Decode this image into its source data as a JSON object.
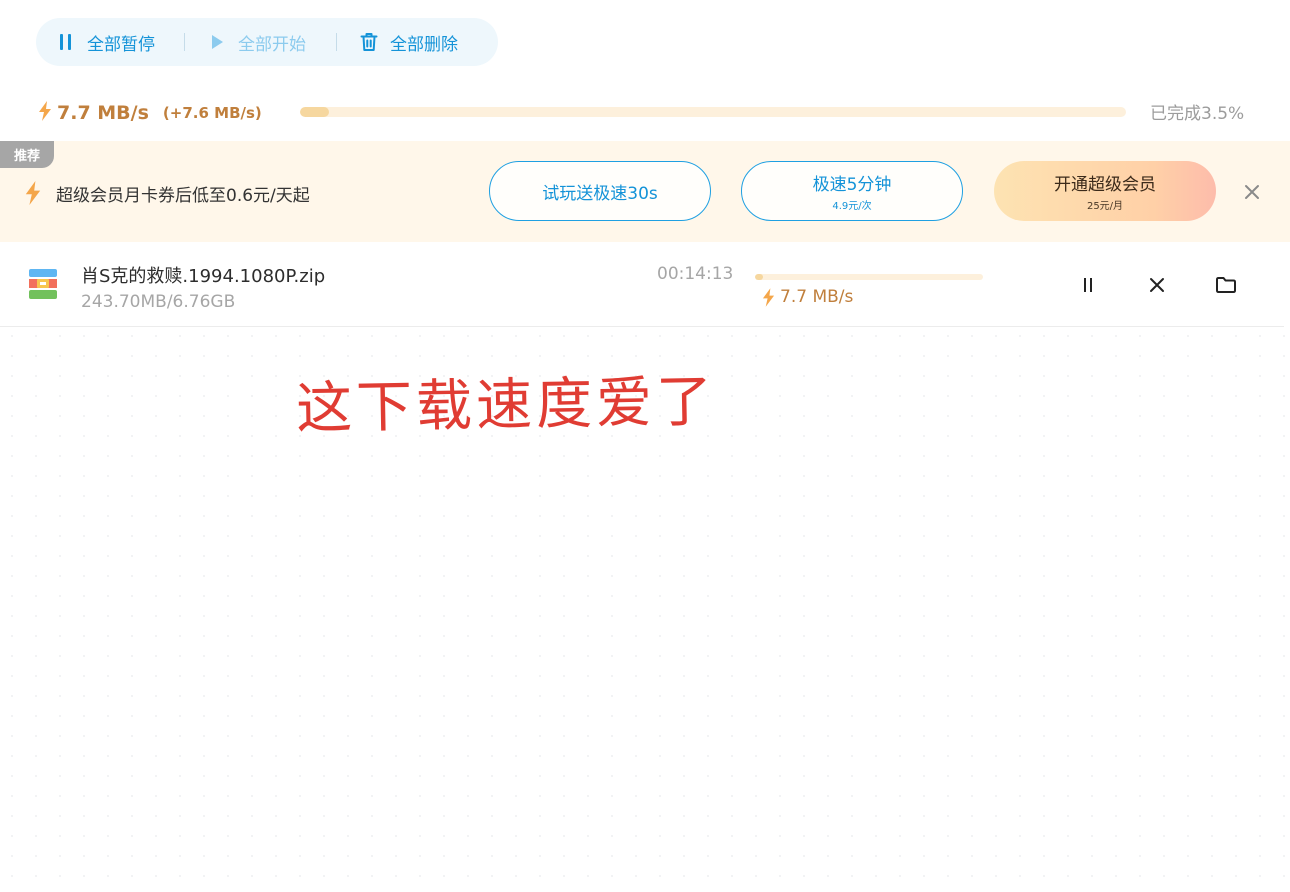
{
  "toolbar": {
    "pause_all": "全部暂停",
    "start_all": "全部开始",
    "delete_all": "全部删除"
  },
  "overall": {
    "speed": "7.7 MB/s",
    "speed_delta": "(+7.6 MB/s)",
    "progress_percent": 3.5,
    "completed_label": "已完成3.5%"
  },
  "promo": {
    "tag": "推荐",
    "text": "超级会员月卡券后低至0.6元/天起",
    "trial_button": "试玩送极速30s",
    "boost_button": "极速5分钟",
    "boost_price": "4.9元/次",
    "vip_button": "开通超级会员",
    "vip_price": "25元/月"
  },
  "downloads": [
    {
      "name": "肖S克的救赎.1994.1080P.zip",
      "size": "243.70MB/6.76GB",
      "time_left": "00:14:13",
      "speed": "7.7 MB/s",
      "progress_percent": 3.5
    }
  ],
  "overlay_text": "这下载速度爱了",
  "colors": {
    "accent_blue": "#1493d8",
    "speed_orange": "#c07f3c",
    "promo_bg": "#fff7ea",
    "handwriting_red": "#e03c33"
  },
  "icons": [
    "pause-icon",
    "play-icon",
    "trash-icon",
    "lightning-icon",
    "archive-file-icon",
    "close-icon",
    "folder-icon"
  ]
}
